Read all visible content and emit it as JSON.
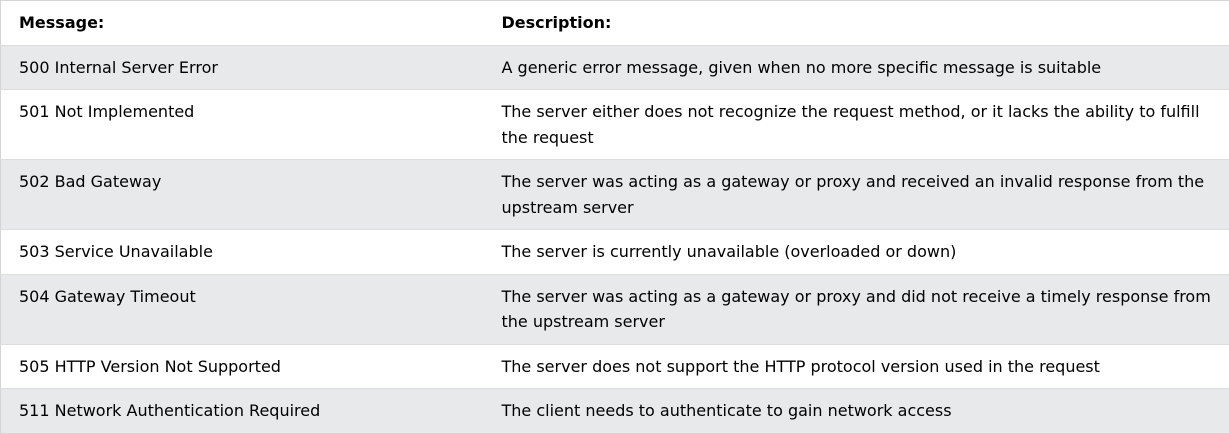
{
  "header": {
    "message_label": "Message:",
    "description_label": "Description:"
  },
  "rows": [
    {
      "message": "500 Internal Server Error",
      "description": "A generic error message, given when no more specific message is suitable"
    },
    {
      "message": "501 Not Implemented",
      "description": "The server either does not recognize the request method, or it lacks the ability to fulfill the request"
    },
    {
      "message": "502 Bad Gateway",
      "description": "The server was acting as a gateway or proxy and received an invalid response from the upstream server"
    },
    {
      "message": "503 Service Unavailable",
      "description": "The server is currently unavailable (overloaded or down)"
    },
    {
      "message": "504 Gateway Timeout",
      "description": "The server was acting as a gateway or proxy and did not receive a timely response from the upstream server"
    },
    {
      "message": "505 HTTP Version Not Supported",
      "description": "The server does not support the HTTP protocol version used in the request"
    },
    {
      "message": "511 Network Authentication Required",
      "description": "The client needs to authenticate to gain network access"
    }
  ],
  "colors": {
    "row_alt": "#e7e9eb",
    "row_plain": "#ffffff",
    "border": "#dddddd"
  }
}
